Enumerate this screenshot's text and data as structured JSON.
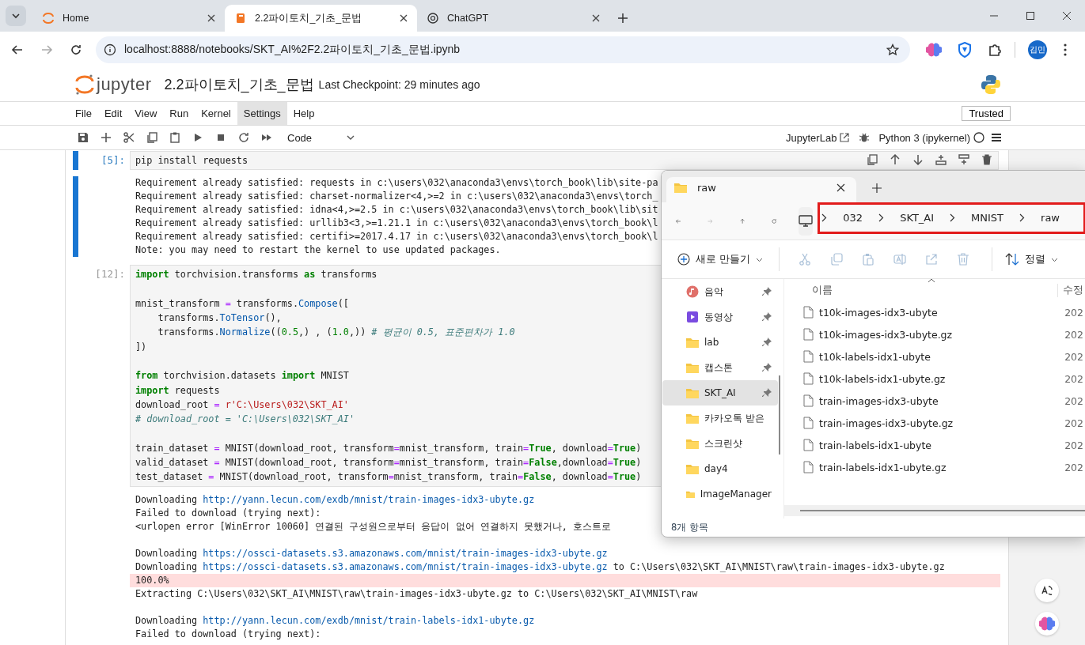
{
  "browser": {
    "tabs": [
      {
        "title": "Home",
        "kind": "jupyter",
        "selected": false
      },
      {
        "title": "2.2파이토치_기초_문법",
        "kind": "notebook",
        "selected": true
      },
      {
        "title": "ChatGPT",
        "kind": "chatgpt",
        "selected": false
      }
    ],
    "url": "localhost:8888/notebooks/SKT_AI%2F2.2파이토치_기초_문법.ipynb",
    "profile": "김민"
  },
  "jupyter": {
    "logo_text": "jupyter",
    "title": "2.2파이토치_기초_문법",
    "checkpoint": "Last Checkpoint: 29 minutes ago",
    "menu": [
      {
        "label": "File",
        "selected": false
      },
      {
        "label": "Edit",
        "selected": false
      },
      {
        "label": "View",
        "selected": false
      },
      {
        "label": "Run",
        "selected": false
      },
      {
        "label": "Kernel",
        "selected": false
      },
      {
        "label": "Settings",
        "selected": true
      },
      {
        "label": "Help",
        "selected": false
      }
    ],
    "trusted": "Trusted",
    "cell_type": "Code",
    "jupyterlab_link": "JupyterLab",
    "kernel": "Python 3 (ipykernel)"
  },
  "cells": [
    {
      "prompt": "[5]:",
      "selected": true,
      "code": [
        {
          "tokens": [
            {
              "kind": "plain",
              "t": "pip install requests"
            }
          ]
        }
      ],
      "outputs": [
        {
          "kind": "stdout",
          "parts": [
            {
              "kind": "text",
              "t": "Requirement already satisfied: requests in c:\\users\\032\\anaconda3\\envs\\torch_book\\lib\\site-pa"
            }
          ]
        },
        {
          "kind": "stdout",
          "parts": [
            {
              "kind": "text",
              "t": "Requirement already satisfied: charset-normalizer<4,>=2 in c:\\users\\032\\anaconda3\\envs\\torch_"
            }
          ]
        },
        {
          "kind": "stdout",
          "parts": [
            {
              "kind": "text",
              "t": "Requirement already satisfied: idna<4,>=2.5 in c:\\users\\032\\anaconda3\\envs\\torch_book\\lib\\sit"
            }
          ]
        },
        {
          "kind": "stdout",
          "parts": [
            {
              "kind": "text",
              "t": "Requirement already satisfied: urllib3<3,>=1.21.1 in c:\\users\\032\\anaconda3\\envs\\torch_book\\l"
            }
          ]
        },
        {
          "kind": "stdout",
          "parts": [
            {
              "kind": "text",
              "t": "Requirement already satisfied: certifi>=2017.4.17 in c:\\users\\032\\anaconda3\\envs\\torch_book\\l"
            }
          ]
        },
        {
          "kind": "stdout",
          "parts": [
            {
              "kind": "text",
              "t": "Note: you may need to restart the kernel to use updated packages."
            }
          ]
        }
      ]
    },
    {
      "prompt": "[12]:",
      "selected": false,
      "code": [
        {
          "tokens": [
            {
              "kind": "kw",
              "t": "import"
            },
            {
              "kind": "plain",
              "t": " torchvision.transforms "
            },
            {
              "kind": "kw",
              "t": "as"
            },
            {
              "kind": "plain",
              "t": " transforms"
            }
          ]
        },
        {
          "kind": "blank"
        },
        {
          "tokens": [
            {
              "kind": "plain",
              "t": "mnist_transform "
            },
            {
              "kind": "op",
              "t": "="
            },
            {
              "kind": "plain",
              "t": " transforms."
            },
            {
              "kind": "fn",
              "t": "Compose"
            },
            {
              "kind": "plain",
              "t": "(["
            }
          ]
        },
        {
          "tokens": [
            {
              "kind": "plain",
              "t": "    transforms."
            },
            {
              "kind": "fn",
              "t": "ToTensor"
            },
            {
              "kind": "plain",
              "t": "(),"
            }
          ]
        },
        {
          "tokens": [
            {
              "kind": "plain",
              "t": "    transforms."
            },
            {
              "kind": "fn",
              "t": "Normalize"
            },
            {
              "kind": "plain",
              "t": "(("
            },
            {
              "kind": "num",
              "t": "0.5"
            },
            {
              "kind": "plain",
              "t": ",) , ("
            },
            {
              "kind": "num",
              "t": "1.0"
            },
            {
              "kind": "plain",
              "t": ",)) "
            },
            {
              "kind": "comment",
              "t": "# 평균이 0.5, 표준편차가 1.0"
            }
          ]
        },
        {
          "tokens": [
            {
              "kind": "plain",
              "t": "])"
            }
          ]
        },
        {
          "kind": "blank"
        },
        {
          "tokens": [
            {
              "kind": "kw",
              "t": "from"
            },
            {
              "kind": "plain",
              "t": " torchvision.datasets "
            },
            {
              "kind": "kw",
              "t": "import"
            },
            {
              "kind": "plain",
              "t": " MNIST"
            }
          ]
        },
        {
          "tokens": [
            {
              "kind": "kw",
              "t": "import"
            },
            {
              "kind": "plain",
              "t": " requests"
            }
          ]
        },
        {
          "tokens": [
            {
              "kind": "plain",
              "t": "download_root "
            },
            {
              "kind": "op",
              "t": "="
            },
            {
              "kind": "str",
              "t": " r'C:\\Users\\032\\SKT_AI'"
            }
          ]
        },
        {
          "tokens": [
            {
              "kind": "comment",
              "t": "# download_root = 'C:\\Users\\032\\SKT_AI'"
            }
          ]
        },
        {
          "kind": "blank"
        },
        {
          "tokens": [
            {
              "kind": "plain",
              "t": "train_dataset "
            },
            {
              "kind": "op",
              "t": "="
            },
            {
              "kind": "plain",
              "t": " MNIST(download_root, transform"
            },
            {
              "kind": "op",
              "t": "="
            },
            {
              "kind": "plain",
              "t": "mnist_transform, train"
            },
            {
              "kind": "op",
              "t": "="
            },
            {
              "kind": "kw",
              "t": "True"
            },
            {
              "kind": "plain",
              "t": ", download"
            },
            {
              "kind": "op",
              "t": "="
            },
            {
              "kind": "kw",
              "t": "True"
            },
            {
              "kind": "plain",
              "t": ")"
            }
          ]
        },
        {
          "tokens": [
            {
              "kind": "plain",
              "t": "valid_dataset "
            },
            {
              "kind": "op",
              "t": "="
            },
            {
              "kind": "plain",
              "t": " MNIST(download_root, transform"
            },
            {
              "kind": "op",
              "t": "="
            },
            {
              "kind": "plain",
              "t": "mnist_transform, train"
            },
            {
              "kind": "op",
              "t": "="
            },
            {
              "kind": "kw",
              "t": "False"
            },
            {
              "kind": "plain",
              "t": ",download"
            },
            {
              "kind": "op",
              "t": "="
            },
            {
              "kind": "kw",
              "t": "True"
            },
            {
              "kind": "plain",
              "t": ")"
            }
          ]
        },
        {
          "tokens": [
            {
              "kind": "plain",
              "t": "test_dataset "
            },
            {
              "kind": "op",
              "t": "="
            },
            {
              "kind": "plain",
              "t": " MNIST(download_root, transform"
            },
            {
              "kind": "op",
              "t": "="
            },
            {
              "kind": "plain",
              "t": "mnist_transform, train"
            },
            {
              "kind": "op",
              "t": "="
            },
            {
              "kind": "kw",
              "t": "False"
            },
            {
              "kind": "plain",
              "t": ", download"
            },
            {
              "kind": "op",
              "t": "="
            },
            {
              "kind": "kw",
              "t": "True"
            },
            {
              "kind": "plain",
              "t": ")"
            }
          ]
        }
      ],
      "outputs": [
        {
          "kind": "stdout",
          "parts": [
            {
              "kind": "text",
              "t": "Downloading "
            },
            {
              "kind": "link",
              "t": "http://yann.lecun.com/exdb/mnist/train-images-idx3-ubyte.gz"
            }
          ]
        },
        {
          "kind": "stdout",
          "parts": [
            {
              "kind": "text",
              "t": "Failed to download (trying next):"
            }
          ]
        },
        {
          "kind": "stdout",
          "parts": [
            {
              "kind": "text",
              "t": "<urlopen error [WinError 10060] 연결된 구성원으로부터 응답이 없어 연결하지 못했거나, 호스트로"
            }
          ]
        },
        {
          "kind": "blank"
        },
        {
          "kind": "stdout",
          "parts": [
            {
              "kind": "text",
              "t": "Downloading "
            },
            {
              "kind": "link",
              "t": "https://ossci-datasets.s3.amazonaws.com/mnist/train-images-idx3-ubyte.gz"
            }
          ]
        },
        {
          "kind": "stdout",
          "parts": [
            {
              "kind": "text",
              "t": "Downloading "
            },
            {
              "kind": "link",
              "t": "https://ossci-datasets.s3.amazonaws.com/mnist/train-images-idx3-ubyte.gz"
            },
            {
              "kind": "text",
              "t": " to C:\\Users\\032\\SKT_AI\\MNIST\\raw\\train-images-idx3-ubyte.gz"
            }
          ]
        },
        {
          "kind": "stderr",
          "parts": [
            {
              "kind": "text",
              "t": "100.0%"
            }
          ]
        },
        {
          "kind": "stdout",
          "parts": [
            {
              "kind": "text",
              "t": "Extracting C:\\Users\\032\\SKT_AI\\MNIST\\raw\\train-images-idx3-ubyte.gz to C:\\Users\\032\\SKT_AI\\MNIST\\raw"
            }
          ]
        },
        {
          "kind": "blank"
        },
        {
          "kind": "stdout",
          "parts": [
            {
              "kind": "text",
              "t": "Downloading "
            },
            {
              "kind": "link",
              "t": "http://yann.lecun.com/exdb/mnist/train-labels-idx1-ubyte.gz"
            }
          ]
        },
        {
          "kind": "stdout",
          "parts": [
            {
              "kind": "text",
              "t": "Failed to download (trying next):"
            }
          ]
        }
      ]
    }
  ],
  "explorer": {
    "tab": "raw",
    "breadcrumb": [
      "032",
      "SKT_AI",
      "MNIST",
      "raw"
    ],
    "new_button": "새로 만들기",
    "sort_button": "정렬",
    "nav_items": [
      {
        "label": "음악",
        "kind": "music",
        "pinned": true,
        "selected": false
      },
      {
        "label": "동영상",
        "kind": "video",
        "pinned": true,
        "selected": false
      },
      {
        "label": "lab",
        "kind": "folder",
        "pinned": true,
        "selected": false
      },
      {
        "label": "캡스톤",
        "kind": "folder",
        "pinned": true,
        "selected": false
      },
      {
        "label": "SKT_AI",
        "kind": "folder",
        "pinned": true,
        "selected": true
      },
      {
        "label": "카카오톡 받은",
        "kind": "folder",
        "pinned": false,
        "selected": false
      },
      {
        "label": "스크린샷",
        "kind": "folder",
        "pinned": false,
        "selected": false
      },
      {
        "label": "day4",
        "kind": "folder",
        "pinned": false,
        "selected": false
      },
      {
        "label": "ImageManager",
        "kind": "folder",
        "pinned": false,
        "selected": false
      }
    ],
    "columns": [
      "이름",
      "수정"
    ],
    "files": [
      {
        "name": "t10k-images-idx3-ubyte",
        "date": "202"
      },
      {
        "name": "t10k-images-idx3-ubyte.gz",
        "date": "202"
      },
      {
        "name": "t10k-labels-idx1-ubyte",
        "date": "202"
      },
      {
        "name": "t10k-labels-idx1-ubyte.gz",
        "date": "202"
      },
      {
        "name": "train-images-idx3-ubyte",
        "date": "202"
      },
      {
        "name": "train-images-idx3-ubyte.gz",
        "date": "202"
      },
      {
        "name": "train-labels-idx1-ubyte",
        "date": "202"
      },
      {
        "name": "train-labels-idx1-ubyte.gz",
        "date": "202"
      }
    ],
    "status": "8개 항목"
  }
}
